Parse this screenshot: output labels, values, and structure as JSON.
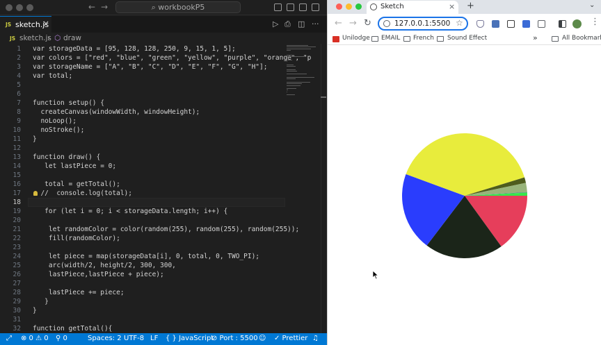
{
  "vscode": {
    "title_search": "workbookP5",
    "tab": {
      "label": "sketch.js",
      "icon": "JS"
    },
    "breadcrumb": {
      "file": "sketch.js",
      "symbol": "draw",
      "separator": "›"
    },
    "code_lines": [
      {
        "n": "1",
        "text": "var storageData = [95, 128, 128, 250, 9, 15, 1, 5];"
      },
      {
        "n": "2",
        "text": "var colors = [\"red\", \"blue\", \"green\", \"yellow\", \"purple\", \"orange\", \"p"
      },
      {
        "n": "3",
        "text": "var storageName = [\"A\", \"B\", \"C\", \"D\", \"E\", \"F\", \"G\", \"H\"];"
      },
      {
        "n": "4",
        "text": "var total;"
      },
      {
        "n": "5",
        "text": ""
      },
      {
        "n": "6",
        "text": ""
      },
      {
        "n": "7",
        "text": "function setup() {"
      },
      {
        "n": "8",
        "text": "  createCanvas(windowWidth, windowHeight);"
      },
      {
        "n": "9",
        "text": "  noLoop();"
      },
      {
        "n": "10",
        "text": "  noStroke();"
      },
      {
        "n": "11",
        "text": "}"
      },
      {
        "n": "12",
        "text": ""
      },
      {
        "n": "13",
        "text": "function draw() {"
      },
      {
        "n": "14",
        "text": "   let lastPiece = 0;"
      },
      {
        "n": "15",
        "text": ""
      },
      {
        "n": "16",
        "text": "   total = getTotal();"
      },
      {
        "n": "17",
        "text": "  //  console.log(total);"
      },
      {
        "n": "18",
        "text": ""
      },
      {
        "n": "19",
        "text": "   for (let i = 0; i < storageData.length; i++) {"
      },
      {
        "n": "20",
        "text": ""
      },
      {
        "n": "21",
        "text": "    let randomColor = color(random(255), random(255), random(255));"
      },
      {
        "n": "22",
        "text": "    fill(randomColor);"
      },
      {
        "n": "23",
        "text": ""
      },
      {
        "n": "24",
        "text": "    let piece = map(storageData[i], 0, total, 0, TWO_PI);"
      },
      {
        "n": "25",
        "text": "    arc(width/2, height/2, 300, 300,"
      },
      {
        "n": "26",
        "text": "    lastPiece,lastPiece + piece);"
      },
      {
        "n": "27",
        "text": ""
      },
      {
        "n": "28",
        "text": "    lastPiece += piece;"
      },
      {
        "n": "29",
        "text": "   }"
      },
      {
        "n": "30",
        "text": "}"
      },
      {
        "n": "31",
        "text": ""
      },
      {
        "n": "32",
        "text": "function getTotal(){"
      }
    ],
    "status": {
      "remote": "⤢",
      "problems": "⊗ 0 ⚠ 0",
      "ports": "⚲ 0",
      "spaces": "Spaces: 2",
      "encoding": "UTF-8",
      "eol": "LF",
      "language": "{ } JavaScript",
      "port": "⊘ Port : 5500",
      "prettier": "✓ Prettier"
    }
  },
  "browser": {
    "tab_title": "Sketch",
    "url": "127.0.0.1:5500",
    "bookmarks": [
      "Unilodge",
      "EMAIL",
      "French",
      "Sound Effect"
    ],
    "all_bookmarks": "All Bookmarks",
    "more": "»"
  },
  "pie": {
    "values": [
      95,
      128,
      128,
      250,
      9,
      15,
      1,
      5
    ],
    "colors": [
      "#e63e5b",
      "#1b2519",
      "#2a3dfd",
      "#e8ec3c",
      "#4e5c1d",
      "#98b47a",
      "#4d8e84",
      "#36e84a"
    ]
  }
}
